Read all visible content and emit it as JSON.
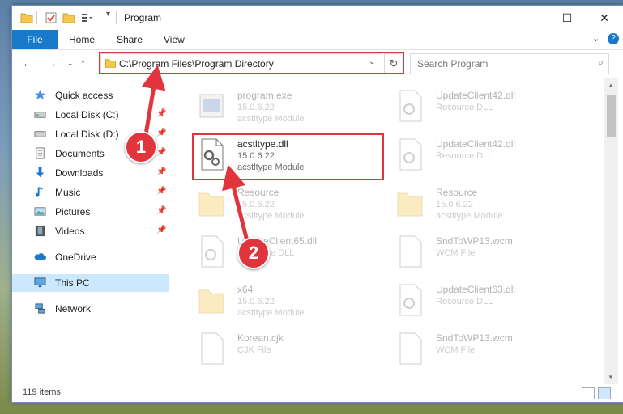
{
  "window": {
    "title": "Program",
    "controls": {
      "minimize": "—",
      "maximize": "☐",
      "close": "✕"
    }
  },
  "ribbon": {
    "file_tab": "File",
    "tabs": [
      "Home",
      "Share",
      "View"
    ],
    "help": "?"
  },
  "address_bar": {
    "path": "C:\\Program Files\\Program Directory",
    "refresh": "↻"
  },
  "search": {
    "placeholder": "Search Program"
  },
  "sidebar": {
    "items": [
      {
        "label": "Quick access",
        "icon": "star-icon",
        "pinned": false,
        "selected": false
      },
      {
        "label": "Local Disk (C:)",
        "icon": "drive-icon",
        "pinned": true,
        "selected": false
      },
      {
        "label": "Local Disk (D:)",
        "icon": "drive-icon",
        "pinned": true,
        "selected": false
      },
      {
        "label": "Documents",
        "icon": "documents-icon",
        "pinned": true,
        "selected": false
      },
      {
        "label": "Downloads",
        "icon": "download-arrow-icon",
        "pinned": true,
        "selected": false
      },
      {
        "label": "Music",
        "icon": "music-note-icon",
        "pinned": true,
        "selected": false
      },
      {
        "label": "Pictures",
        "icon": "pictures-icon",
        "pinned": true,
        "selected": false
      },
      {
        "label": "Videos",
        "icon": "film-icon",
        "pinned": true,
        "selected": false
      },
      {
        "label": "OneDrive",
        "icon": "cloud-icon",
        "pinned": false,
        "selected": false
      },
      {
        "label": "This PC",
        "icon": "monitor-icon",
        "pinned": false,
        "selected": true
      },
      {
        "label": "Network",
        "icon": "network-icon",
        "pinned": false,
        "selected": false
      }
    ]
  },
  "files": [
    {
      "name": "program.exe",
      "version": "15.0.6.22",
      "type": "acstltype Module",
      "icon": "exe-icon",
      "faded": true
    },
    {
      "name": "UpdateClient42.dll",
      "version": "",
      "type": "Resource DLL",
      "icon": "dll-icon",
      "faded": true
    },
    {
      "name": "acstltype.dll",
      "version": "15.0.6.22",
      "type": "acstltype Module",
      "icon": "dll-gear-icon",
      "faded": false
    },
    {
      "name": "UpdateClient42.dll",
      "version": "",
      "type": "Resource DLL",
      "icon": "dll-icon",
      "faded": true
    },
    {
      "name": "Resource",
      "version": "15.0.6.22",
      "type": "acstltype Module",
      "icon": "folder-icon",
      "faded": true
    },
    {
      "name": "Resource",
      "version": "15.0.6.22",
      "type": "acstltype Module",
      "icon": "folder-icon",
      "faded": true
    },
    {
      "name": "UpdateClient65.dll",
      "version": "",
      "type": "Resource DLL",
      "icon": "dll-icon",
      "faded": true
    },
    {
      "name": "SndToWP13.wcm",
      "version": "",
      "type": "WCM File",
      "icon": "file-icon",
      "faded": true
    },
    {
      "name": "x64",
      "version": "15.0.6.22",
      "type": "acstltype Module",
      "icon": "folder-icon",
      "faded": true
    },
    {
      "name": "UpdateClient63.dll",
      "version": "",
      "type": "Resource DLL",
      "icon": "dll-icon",
      "faded": true
    },
    {
      "name": "Korean.cjk",
      "version": "",
      "type": "CJK File",
      "icon": "file-icon",
      "faded": true
    },
    {
      "name": "SndToWP13.wcm",
      "version": "",
      "type": "WCM File",
      "icon": "file-icon",
      "faded": true
    }
  ],
  "status": {
    "items_count": "119 items"
  },
  "callouts": [
    "1",
    "2"
  ],
  "colors": {
    "accent": "#1979ca",
    "highlight_red": "#e0353d",
    "selected_bg": "#cce8ff"
  }
}
